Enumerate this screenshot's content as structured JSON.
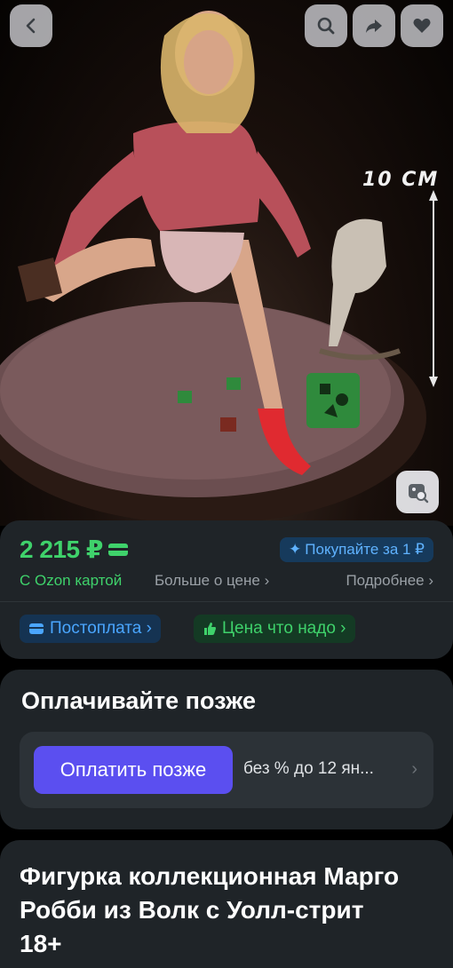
{
  "header": {
    "back_icon": "chevron-left-icon",
    "search_icon": "search-icon",
    "share_icon": "share-arrow-icon",
    "favorite_icon": "heart-icon"
  },
  "hero": {
    "size_label": "10 CM",
    "lens_icon": "image-search-icon"
  },
  "price": {
    "value": "2 215 ₽",
    "card_note": "С Ozon картой",
    "more_about_price": "Больше о цене ›",
    "details_link": "Подробнее ›",
    "buy_for_badge": "Покупайте за 1 ₽",
    "chip_postpay": "Постоплата ›",
    "chip_fair_price": "Цена что надо ›",
    "accent_green": "#3fd26b",
    "accent_blue": "#4aa6ff"
  },
  "pay_later": {
    "title": "Оплачивайте позже",
    "button": "Оплатить позже",
    "terms": "без % до 12 ян...",
    "chevron": "›",
    "button_color": "#5b4ff0"
  },
  "product": {
    "title": "Фигурка коллекционная Марго Робби из Волк с Уолл-стрит 18+"
  }
}
